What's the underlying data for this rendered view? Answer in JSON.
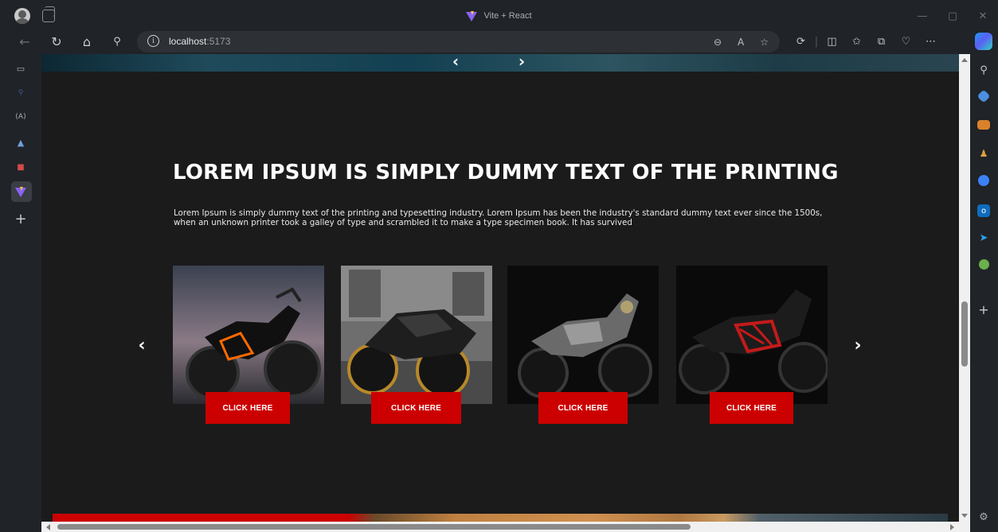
{
  "browser": {
    "window_title": "Vite + React",
    "address": {
      "host": "localhost",
      "port": ":5173"
    },
    "window_controls": {
      "minimize": "—",
      "maximize": "▢",
      "close": "✕"
    }
  },
  "page": {
    "hero_nav": {
      "prev": "‹",
      "next": "›"
    },
    "section": {
      "headline": "LOREM IPSUM IS SIMPLY DUMMY TEXT OF THE PRINTING",
      "paragraph": "Lorem Ipsum is simply dummy text of the printing and typesetting industry. Lorem Ipsum has been the industry's standard dummy text ever since the 1500s, when an unknown printer took a galley of type and scrambled it to make a type specimen book. It has survived",
      "carousel_prev": "‹",
      "carousel_next": "›",
      "cards": [
        {
          "button_label": "CLICK HERE"
        },
        {
          "button_label": "CLICK HERE"
        },
        {
          "button_label": "CLICK HERE"
        },
        {
          "button_label": "CLICK HERE"
        }
      ]
    }
  },
  "colors": {
    "accent_red": "#cc0000",
    "page_background": "#1b1b1c",
    "browser_chrome": "#202327"
  },
  "icons": {
    "titlebar": [
      "profile-avatar-icon",
      "tab-actions-icon",
      "vite-logo-icon"
    ],
    "nav": [
      "back-icon",
      "refresh-icon",
      "home-icon",
      "search-icon",
      "site-info-icon"
    ],
    "address_bar": [
      "zoom-icon",
      "read-aloud-icon",
      "favorite-star-icon"
    ],
    "toolbar": [
      "extensions-icon",
      "split-screen-icon",
      "favorites-icon",
      "collections-icon",
      "browser-essentials-icon",
      "more-icon",
      "copilot-icon"
    ],
    "left_sidebar": [
      "tab-sidebar-icon",
      "search-tab-icon",
      "translate-tab-icon",
      "photos-tab-icon",
      "app-tab-icon",
      "vite-tab-icon",
      "new-tab-icon"
    ],
    "right_sidebar": [
      "search-icon",
      "shopping-icon",
      "tools-icon",
      "people-icon",
      "copilot-app-icon",
      "outlook-icon",
      "telegram-icon",
      "tree-icon",
      "add-icon",
      "settings-icon"
    ]
  }
}
